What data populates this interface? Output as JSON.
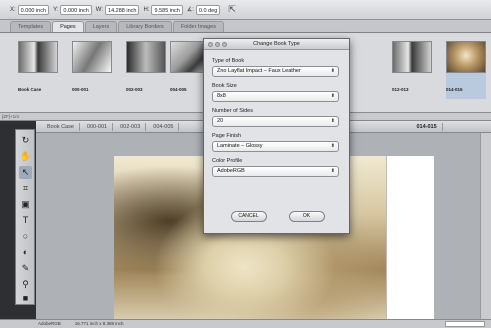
{
  "control_bar": {
    "x_label": "X:",
    "x_value": "0.000 inch",
    "y_label": "Y:",
    "y_value": "0.000 inch",
    "w_label": "W:",
    "w_value": "14.288 inch",
    "h_label": "H:",
    "h_value": "9.585 inch",
    "angle_label": "∡:",
    "angle_value": "0.0 deg",
    "fit_icon": "fit-icon"
  },
  "tabs": [
    "Templates",
    "Pages",
    "Layers",
    "Library Borders",
    "Folder Images"
  ],
  "filmstrip": [
    {
      "caption": "Book Case"
    },
    {
      "caption": "000-001"
    },
    {
      "caption": "002-003"
    },
    {
      "caption": "004-005"
    },
    {
      "caption": "012-013"
    },
    {
      "caption": "014-015"
    }
  ],
  "info_strip": "[ZF]+1/4",
  "doc_tabs": [
    "Book Case",
    "000-001",
    "002-003",
    "004-005",
    "014-015"
  ],
  "dialog": {
    "title": "Change Book Type",
    "fields": [
      {
        "label": "Type of Book",
        "value": "Zno Layflat Impact – Faux Leather"
      },
      {
        "label": "Book Size",
        "value": "8x8"
      },
      {
        "label": "Number of Sides",
        "value": "20"
      },
      {
        "label": "Page Finish",
        "value": "Laminate – Glossy"
      },
      {
        "label": "Color Profile",
        "value": "AdobeRGB"
      }
    ],
    "cancel_label": "CANCEL",
    "ok_label": "OK"
  },
  "status": {
    "color_mode": "AdobeRGB",
    "dimensions": "16.771 inch x 8.388 inch"
  }
}
